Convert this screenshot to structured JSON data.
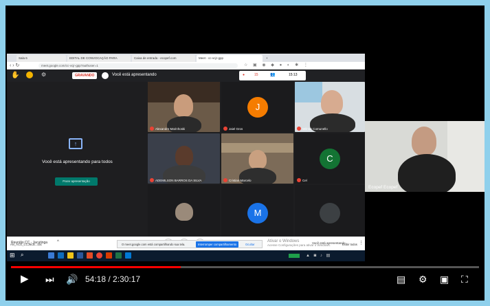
{
  "browser": {
    "tabs": [
      "Sala 6",
      "EDITAL DE CONVOCAÇÃO PARA",
      "Caixa de entrada - ecopef.com",
      "Meet - cc-vcjr-gpp",
      "+"
    ],
    "url": "meet.google.com/cc-vcjr-gpp?authuser=1"
  },
  "meet": {
    "recording_label": "GRAVANDO",
    "presenting_label": "Você está apresentando",
    "participant_count": "15",
    "clock": "15:13",
    "present_message": "Você está apresentando para todos",
    "stop_present_button": "Parar apresentação",
    "participants": [
      {
        "name": "Alexandre Marinhoski"
      },
      {
        "name": "Jaiel Gros",
        "initial": "J"
      },
      {
        "name": "Wilmar Comunello"
      },
      {
        "name": "ADEMILSON BARROS DA SILVA"
      },
      {
        "name": "Cristian Marcelo"
      },
      {
        "name": "Cel",
        "initial": "C"
      },
      {
        "name": "",
        "initial": "M"
      }
    ],
    "meeting_title": "Reunião CC - Jacutinga",
    "present_chip": "Você está apresentando",
    "watermark_line1": "Ativar o Windows",
    "watermark_line2": "Acesse Configurações para ativar o Windows.",
    "share_notice": "O meet.google.com está compartilhando sua tela.",
    "stop_share_button": "Interromper compartilhamento",
    "hide_button": "Ocultar",
    "download_file": "AN_ACO_CCJ6CB...doc",
    "show_all": "Exibir todos"
  },
  "selfview": {
    "name": "Ecopef Ecopef"
  },
  "player": {
    "time_current": "54:18",
    "time_total": "2:30:17",
    "progress": 0.362
  },
  "colors": {
    "progress": "#ff0000",
    "record": "#d93025",
    "avatar_orange": "#f57c00",
    "avatar_green": "#137333",
    "avatar_blue": "#1a73e8"
  }
}
